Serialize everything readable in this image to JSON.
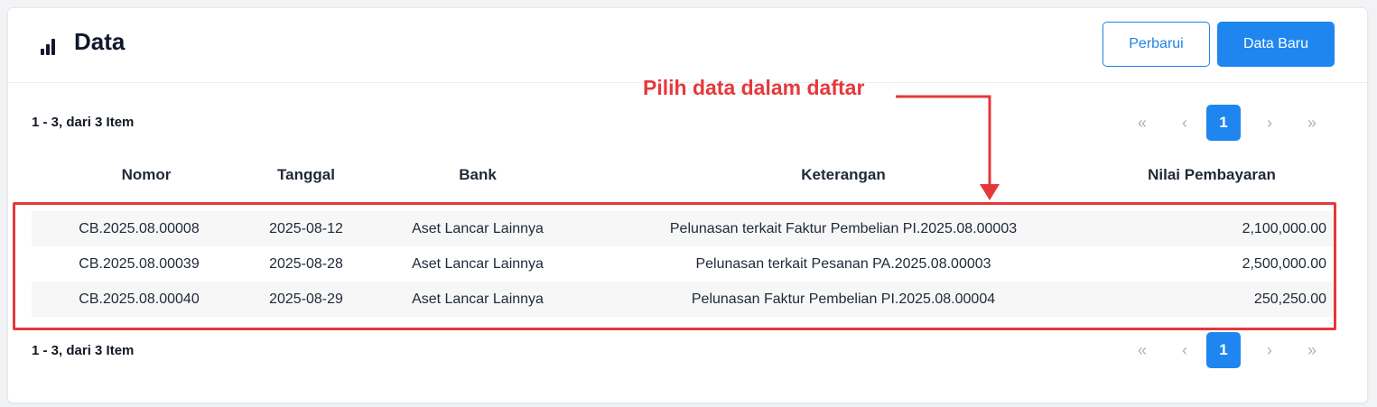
{
  "header": {
    "title": "Data",
    "icon": "bar-chart-icon",
    "refresh_label": "Perbarui",
    "new_label": "Data Baru"
  },
  "summary": {
    "top": "1 - 3, dari 3 Item",
    "bottom": "1 - 3, dari 3 Item"
  },
  "pagination": {
    "first": "«",
    "prev": "‹",
    "current": "1",
    "next": "›",
    "last": "»"
  },
  "table": {
    "columns": [
      "Nomor",
      "Tanggal",
      "Bank",
      "Keterangan",
      "Nilai Pembayaran"
    ],
    "rows": [
      [
        "CB.2025.08.00008",
        "2025-08-12",
        "Aset Lancar Lainnya",
        "Pelunasan terkait Faktur Pembelian PI.2025.08.00003",
        "2,100,000.00"
      ],
      [
        "CB.2025.08.00039",
        "2025-08-28",
        "Aset Lancar Lainnya",
        "Pelunasan terkait Pesanan PA.2025.08.00003",
        "2,500,000.00"
      ],
      [
        "CB.2025.08.00040",
        "2025-08-29",
        "Aset Lancar Lainnya",
        "Pelunasan Faktur Pembelian PI.2025.08.00004",
        "250,250.00"
      ]
    ]
  },
  "annotation": {
    "text": "Pilih data dalam daftar",
    "color": "#e5383b"
  },
  "colors": {
    "primary": "#1f86f0",
    "highlight": "#e5383b"
  }
}
